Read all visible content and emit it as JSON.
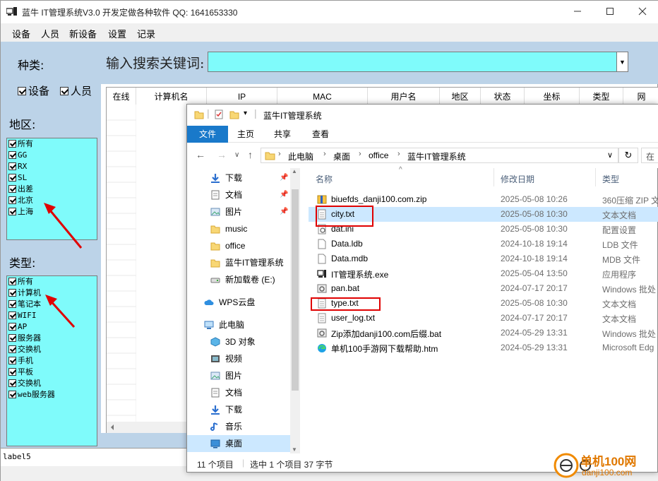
{
  "app": {
    "title": "蓝牛 IT管理系统V3.0   开发定做各种软件 QQ: 1641653330",
    "menu": [
      "设备",
      "人员",
      "新设备",
      "设置",
      "记录"
    ],
    "kind_label": "种类:",
    "kind_checks": [
      "设备",
      "人员"
    ],
    "region_label": "地区:",
    "region_items": [
      "所有",
      "GG",
      "RX",
      "SL",
      "出差",
      "北京",
      "上海"
    ],
    "type_label": "类型:",
    "type_items": [
      "所有",
      "计算机",
      "笔记本",
      "WIFI",
      "AP",
      "服务器",
      "交换机",
      "手机",
      "平板",
      "交换机",
      "web服务器"
    ],
    "search_label": "输入搜索关键词:",
    "search_value": "",
    "columns": [
      "在线",
      "计算机名",
      "IP",
      "MAC",
      "用户名",
      "地区",
      "状态",
      "坐标",
      "类型",
      "网"
    ],
    "status_label": "label5"
  },
  "explorer": {
    "title": "蓝牛IT管理系统",
    "ribbon_tabs": [
      "文件",
      "主页",
      "共享",
      "查看"
    ],
    "breadcrumb": [
      "此电脑",
      "桌面",
      "office",
      "蓝牛IT管理系统"
    ],
    "search_placeholder": "在",
    "nav_items": [
      {
        "label": "下载",
        "icon": "download-arrow-icon",
        "pinned": true
      },
      {
        "label": "文档",
        "icon": "document-icon",
        "pinned": true
      },
      {
        "label": "图片",
        "icon": "picture-icon",
        "pinned": true
      },
      {
        "label": "music",
        "icon": "folder-icon",
        "pinned": false
      },
      {
        "label": "office",
        "icon": "folder-icon",
        "pinned": false
      },
      {
        "label": "蓝牛IT管理系统",
        "icon": "folder-icon",
        "pinned": false
      },
      {
        "label": "新加载卷 (E:)",
        "icon": "drive-icon",
        "pinned": false
      },
      {
        "label": "WPS云盘",
        "icon": "cloud-icon",
        "pinned": false
      },
      {
        "label": "此电脑",
        "icon": "computer-icon",
        "pinned": false
      },
      {
        "label": "3D 对象",
        "icon": "cube-icon",
        "pinned": false
      },
      {
        "label": "视频",
        "icon": "video-icon",
        "pinned": false
      },
      {
        "label": "图片",
        "icon": "picture-icon",
        "pinned": false
      },
      {
        "label": "文档",
        "icon": "document-icon",
        "pinned": false
      },
      {
        "label": "下载",
        "icon": "download-arrow-icon",
        "pinned": false
      },
      {
        "label": "音乐",
        "icon": "music-note-icon",
        "pinned": false
      },
      {
        "label": "桌面",
        "icon": "desktop-icon",
        "pinned": false
      }
    ],
    "headers": {
      "name": "名称",
      "date": "修改日期",
      "type": "类型"
    },
    "files": [
      {
        "name": "biuefds_danji100.com.zip",
        "date": "2025-05-08 10:26",
        "type": "360压缩 ZIP 文",
        "icon": "zip-icon"
      },
      {
        "name": "city.txt",
        "date": "2025-05-08 10:30",
        "type": "文本文档",
        "icon": "text-file-icon"
      },
      {
        "name": "dat.ini",
        "date": "2025-05-08 10:30",
        "type": "配置设置",
        "icon": "ini-file-icon"
      },
      {
        "name": "Data.ldb",
        "date": "2024-10-18 19:14",
        "type": "LDB 文件",
        "icon": "file-icon"
      },
      {
        "name": "Data.mdb",
        "date": "2024-10-18 19:14",
        "type": "MDB 文件",
        "icon": "file-icon"
      },
      {
        "name": "IT管理系统.exe",
        "date": "2025-05-04 13:50",
        "type": "应用程序",
        "icon": "exe-icon"
      },
      {
        "name": "pan.bat",
        "date": "2024-07-17 20:17",
        "type": "Windows 批处",
        "icon": "bat-icon"
      },
      {
        "name": "type.txt",
        "date": "2025-05-08 10:30",
        "type": "文本文档",
        "icon": "text-file-icon"
      },
      {
        "name": "user_log.txt",
        "date": "2024-07-17 20:17",
        "type": "文本文档",
        "icon": "text-file-icon"
      },
      {
        "name": "Zip添加danji100.com后缀.bat",
        "date": "2024-05-29 13:31",
        "type": "Windows 批处",
        "icon": "bat-icon"
      },
      {
        "name": "单机100手游网下载帮助.htm",
        "date": "2024-05-29 13:31",
        "type": "Microsoft Edg",
        "icon": "edge-icon"
      }
    ],
    "selected_file": "city.txt",
    "status": {
      "count": "11 个项目",
      "selected": "选中 1 个项目  37 字节"
    }
  },
  "watermark": {
    "cn": "单机100网",
    "url": "danji100.com"
  },
  "colors": {
    "panel": "#bcd3e8",
    "cyan": "#7ffbfb",
    "accent": "#1979ca",
    "highlight": "#e00000",
    "selection": "#cce8ff"
  }
}
